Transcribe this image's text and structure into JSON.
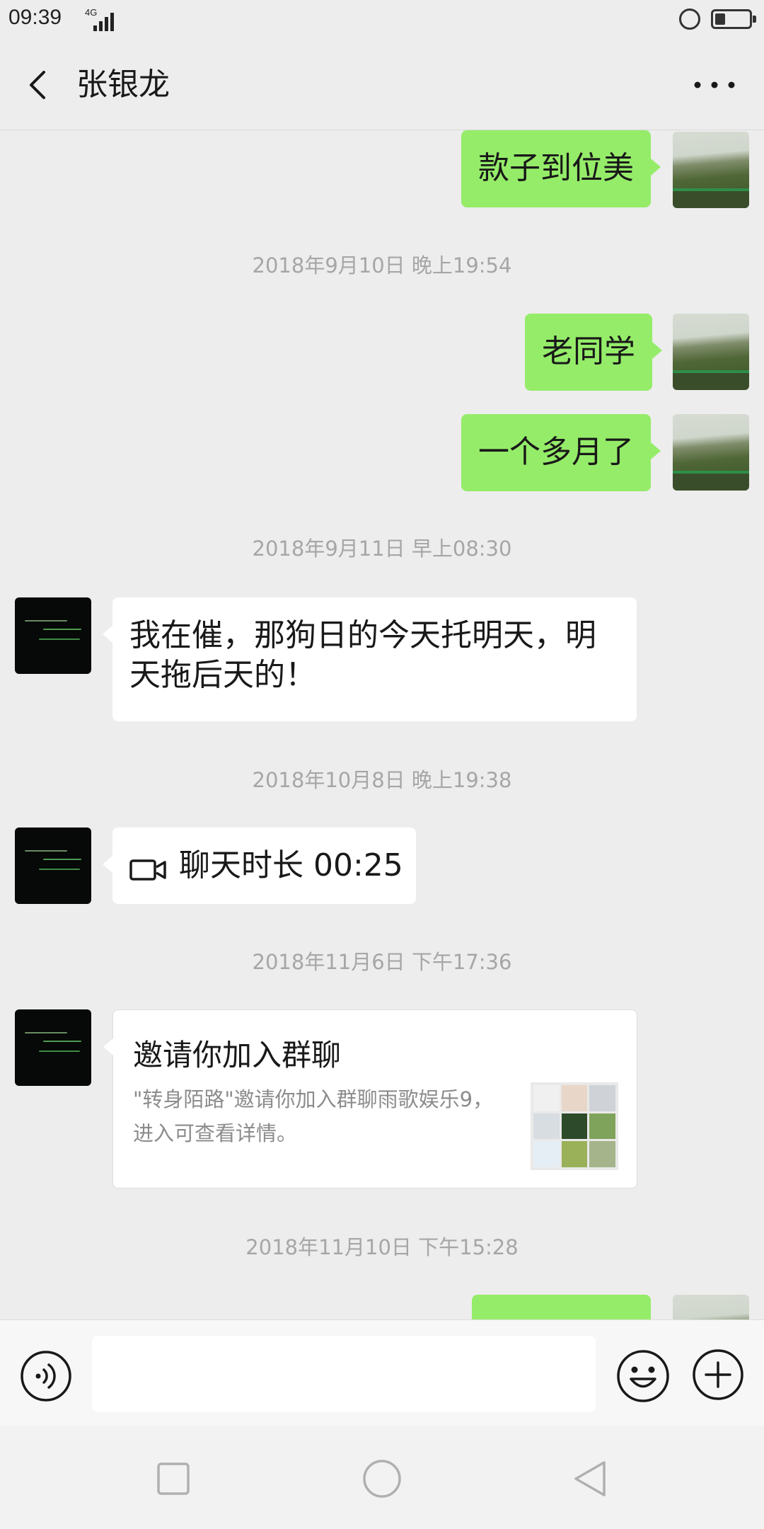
{
  "status_bar": {
    "time": "09:39",
    "network": "4G"
  },
  "nav": {
    "title": "张银龙"
  },
  "messages": {
    "m1": "款子到位美",
    "ts1": "2018年9月10日 晚上19:54",
    "m2": "老同学",
    "m3": "一个多月了",
    "ts2": "2018年9月11日 早上08:30",
    "m4": "我在催，那狗日的今天托明天，明天拖后天的！",
    "ts3": "2018年10月8日 晚上19:38",
    "m5": "聊天时长 00:25",
    "ts4": "2018年11月6日 下午17:36",
    "card": {
      "title": "邀请你加入群聊",
      "desc": "\"转身陌路\"邀请你加入群聊雨歌娱乐9，进入可查看详情。"
    },
    "ts5": "2018年11月10日 下午15:28"
  },
  "input": {
    "value": ""
  },
  "colors": {
    "outgoing_bubble": "#95ec69",
    "incoming_bubble": "#ffffff",
    "background": "#ededed"
  },
  "icons": [
    "back-arrow-icon",
    "more-icon",
    "video-call-icon",
    "voice-icon",
    "emoji-icon",
    "plus-icon",
    "recent-apps-icon",
    "home-icon",
    "system-back-icon"
  ]
}
